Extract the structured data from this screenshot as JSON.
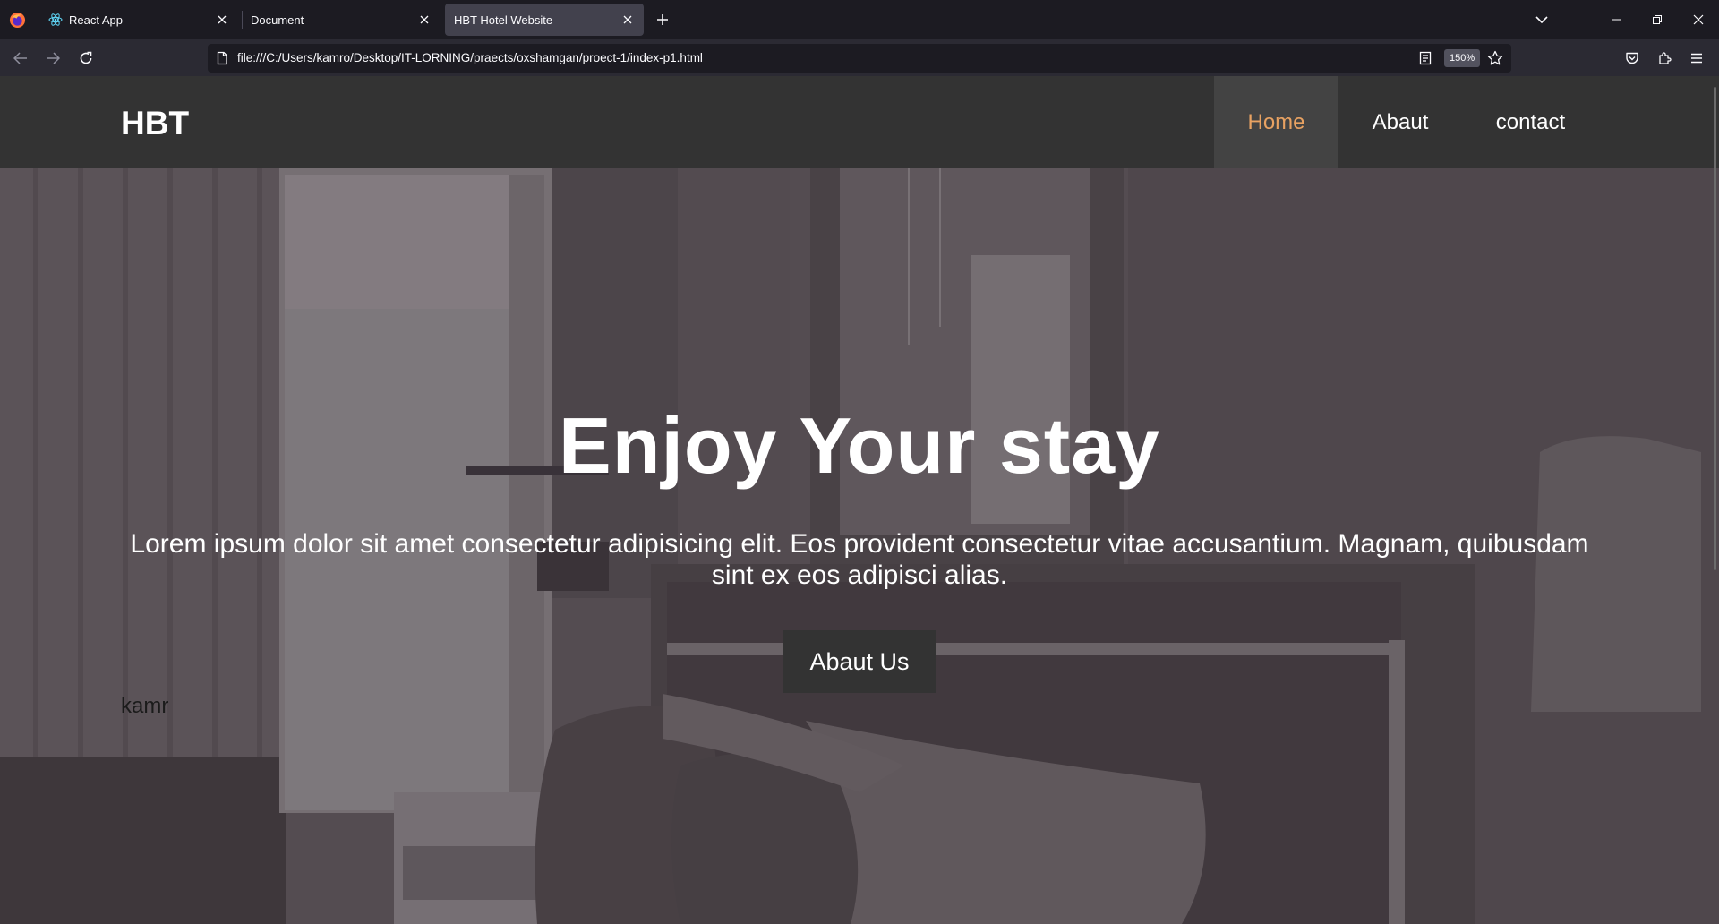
{
  "browser": {
    "tabs": [
      {
        "title": "React App",
        "favicon": "react-icon",
        "active": false
      },
      {
        "title": "Document",
        "favicon": "none",
        "active": false
      },
      {
        "title": "HBT Hotel Website",
        "favicon": "none",
        "active": true
      }
    ],
    "url": "file:///C:/Users/kamro/Desktop/IT-LORNING/praects/oxshamgan/proect-1/index-p1.html",
    "zoom": "150%"
  },
  "site": {
    "brand": "HBT",
    "nav": [
      {
        "label": "Home",
        "active": true
      },
      {
        "label": "Abaut",
        "active": false
      },
      {
        "label": "contact",
        "active": false
      }
    ],
    "hero": {
      "title": "Enjoy Your stay",
      "text": "Lorem ipsum dolor sit amet consectetur adipisicing elit. Eos provident consectetur vitae accusantium. Magnam, quibusdam sint ex eos adipisci alias.",
      "button_label": "Abaut Us"
    },
    "side_note": "kamr"
  },
  "colors": {
    "header_bg": "#333333",
    "active_nav_bg": "#434343",
    "active_nav_text": "#e8a262",
    "button_bg": "#333333"
  }
}
